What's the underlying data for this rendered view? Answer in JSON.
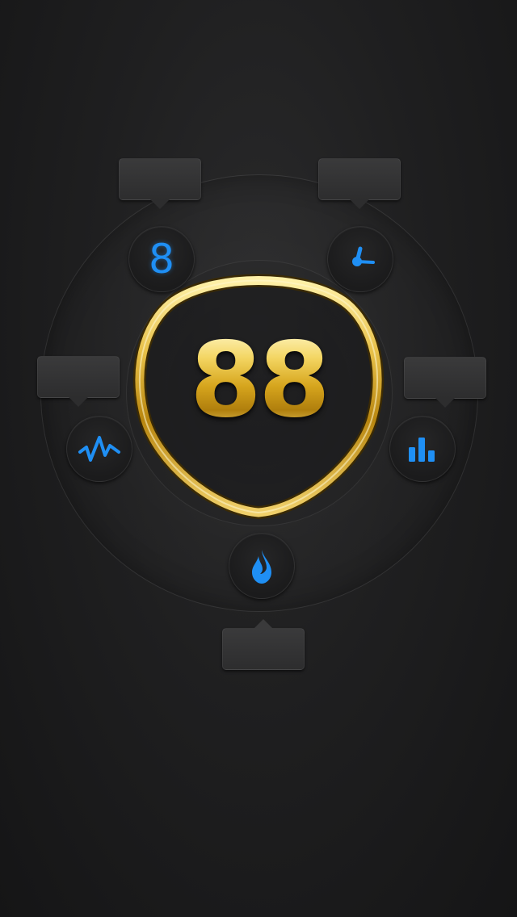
{
  "dial": {
    "value": "88"
  },
  "buttons": [
    {
      "id": "digit",
      "icon": "digit-8-icon",
      "glyph": "8"
    },
    {
      "id": "time",
      "icon": "clock-hands-icon"
    },
    {
      "id": "activity",
      "icon": "pulse-wave-icon"
    },
    {
      "id": "stats",
      "icon": "bar-chart-icon"
    },
    {
      "id": "calories",
      "icon": "flame-icon"
    }
  ],
  "labels": {
    "top_left": "",
    "top_right": "",
    "left": "",
    "right": "",
    "bottom": ""
  },
  "colors": {
    "accent": "#1f8ff4",
    "gold": "#e7c135",
    "background": "#1c1c1d"
  }
}
